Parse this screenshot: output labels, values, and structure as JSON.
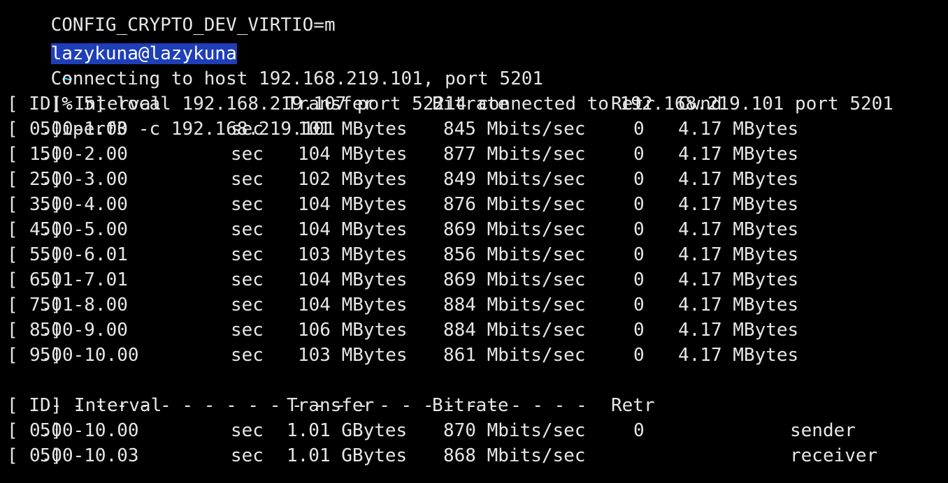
{
  "terminal": {
    "top_partial_line": "CONFIG_CRYPTO_DEV_VIRTIO=m",
    "prompt": {
      "user_host": "lazykuna@lazykuna",
      "cwd": "~",
      "symbol": "%",
      "command": "iperf3 -c 192.168.219.101"
    },
    "connecting_line": "Connecting to host 192.168.219.101, port 5201",
    "local_line": "[  5] local 192.168.219.107 port 52214 connected to 192.168.219.101 port 5201",
    "header": {
      "id": "[ ID]",
      "interval": "Interval",
      "transfer": "Transfer",
      "bitrate": "Bitrate",
      "retr": "Retr",
      "cwnd": "Cwnd"
    },
    "rows": [
      {
        "id": "[  5]",
        "interval": "0.00-1.00",
        "unit": "sec",
        "transfer": "101 MBytes",
        "bitrate": "845 Mbits/sec",
        "retr": "0",
        "cwnd": "4.17 MBytes"
      },
      {
        "id": "[  5]",
        "interval": "1.00-2.00",
        "unit": "sec",
        "transfer": "104 MBytes",
        "bitrate": "877 Mbits/sec",
        "retr": "0",
        "cwnd": "4.17 MBytes"
      },
      {
        "id": "[  5]",
        "interval": "2.00-3.00",
        "unit": "sec",
        "transfer": "102 MBytes",
        "bitrate": "849 Mbits/sec",
        "retr": "0",
        "cwnd": "4.17 MBytes"
      },
      {
        "id": "[  5]",
        "interval": "3.00-4.00",
        "unit": "sec",
        "transfer": "104 MBytes",
        "bitrate": "876 Mbits/sec",
        "retr": "0",
        "cwnd": "4.17 MBytes"
      },
      {
        "id": "[  5]",
        "interval": "4.00-5.00",
        "unit": "sec",
        "transfer": "104 MBytes",
        "bitrate": "869 Mbits/sec",
        "retr": "0",
        "cwnd": "4.17 MBytes"
      },
      {
        "id": "[  5]",
        "interval": "5.00-6.01",
        "unit": "sec",
        "transfer": "103 MBytes",
        "bitrate": "856 Mbits/sec",
        "retr": "0",
        "cwnd": "4.17 MBytes"
      },
      {
        "id": "[  5]",
        "interval": "6.01-7.01",
        "unit": "sec",
        "transfer": "104 MBytes",
        "bitrate": "869 Mbits/sec",
        "retr": "0",
        "cwnd": "4.17 MBytes"
      },
      {
        "id": "[  5]",
        "interval": "7.01-8.00",
        "unit": "sec",
        "transfer": "104 MBytes",
        "bitrate": "884 Mbits/sec",
        "retr": "0",
        "cwnd": "4.17 MBytes"
      },
      {
        "id": "[  5]",
        "interval": "8.00-9.00",
        "unit": "sec",
        "transfer": "106 MBytes",
        "bitrate": "884 Mbits/sec",
        "retr": "0",
        "cwnd": "4.17 MBytes"
      },
      {
        "id": "[  5]",
        "interval": "9.00-10.00",
        "unit": "sec",
        "transfer": "103 MBytes",
        "bitrate": "861 Mbits/sec",
        "retr": "0",
        "cwnd": "4.17 MBytes"
      }
    ],
    "separator": "- - - - - - - - - - - - - - - - - - - - - - - - -",
    "summary_header": {
      "id": "[ ID]",
      "interval": "Interval",
      "transfer": "Transfer",
      "bitrate": "Bitrate",
      "retr": "Retr"
    },
    "summary_rows": [
      {
        "id": "[  5]",
        "interval": "0.00-10.00",
        "unit": "sec",
        "transfer": "1.01 GBytes",
        "bitrate": "870 Mbits/sec",
        "retr": "0",
        "role": "sender"
      },
      {
        "id": "[  5]",
        "interval": "0.00-10.03",
        "unit": "sec",
        "transfer": "1.01 GBytes",
        "bitrate": "868 Mbits/sec",
        "retr": "",
        "role": "receiver"
      }
    ]
  }
}
